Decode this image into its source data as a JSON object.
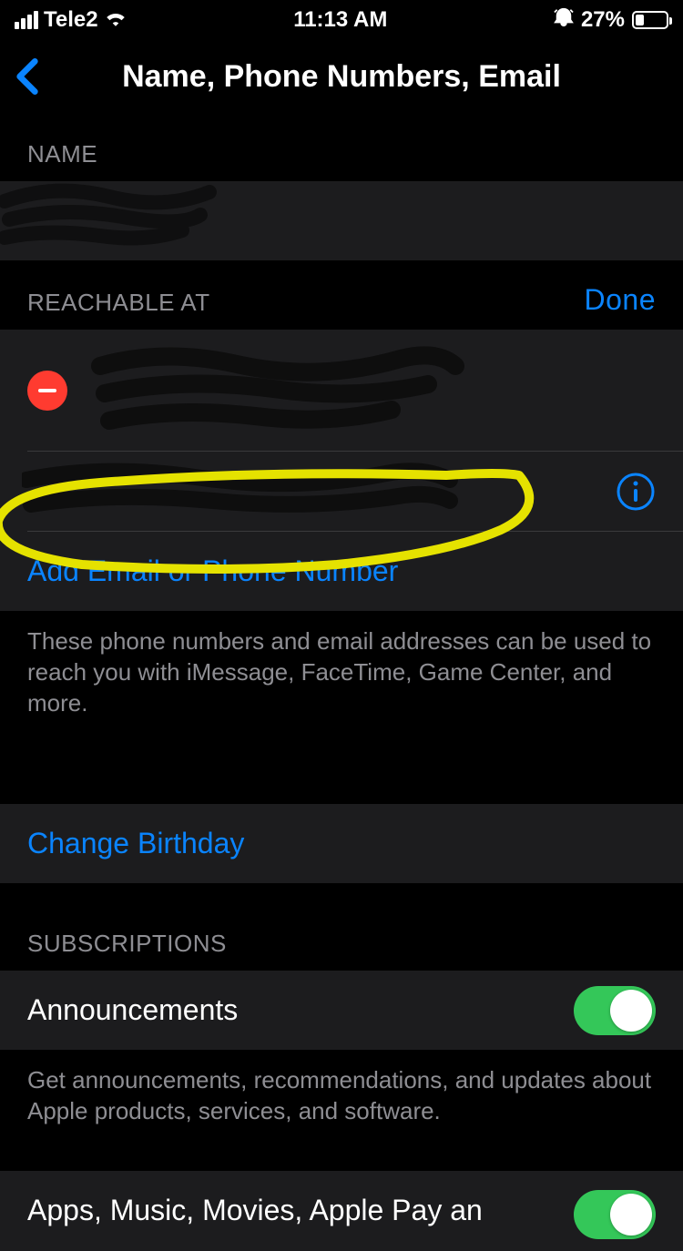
{
  "status": {
    "carrier": "Tele2",
    "time": "11:13 AM",
    "battery_pct": "27%",
    "battery_fill_pct": 27
  },
  "nav": {
    "title": "Name, Phone Numbers, Email"
  },
  "sections": {
    "name": {
      "header": "NAME"
    },
    "reachable": {
      "header": "REACHABLE AT",
      "done_label": "Done",
      "add_label": "Add Email or Phone Number",
      "footer": "These phone numbers and email addresses can be used to reach you with iMessage, FaceTime, Game Center, and more."
    },
    "birthday": {
      "change_label": "Change Birthday"
    },
    "subscriptions": {
      "header": "SUBSCRIPTIONS",
      "items": [
        {
          "label": "Announcements",
          "enabled": true,
          "footer": "Get announcements, recommendations, and updates about Apple products, services, and software."
        },
        {
          "label": "Apps, Music, Movies, Apple Pay an",
          "enabled": true
        }
      ]
    }
  }
}
